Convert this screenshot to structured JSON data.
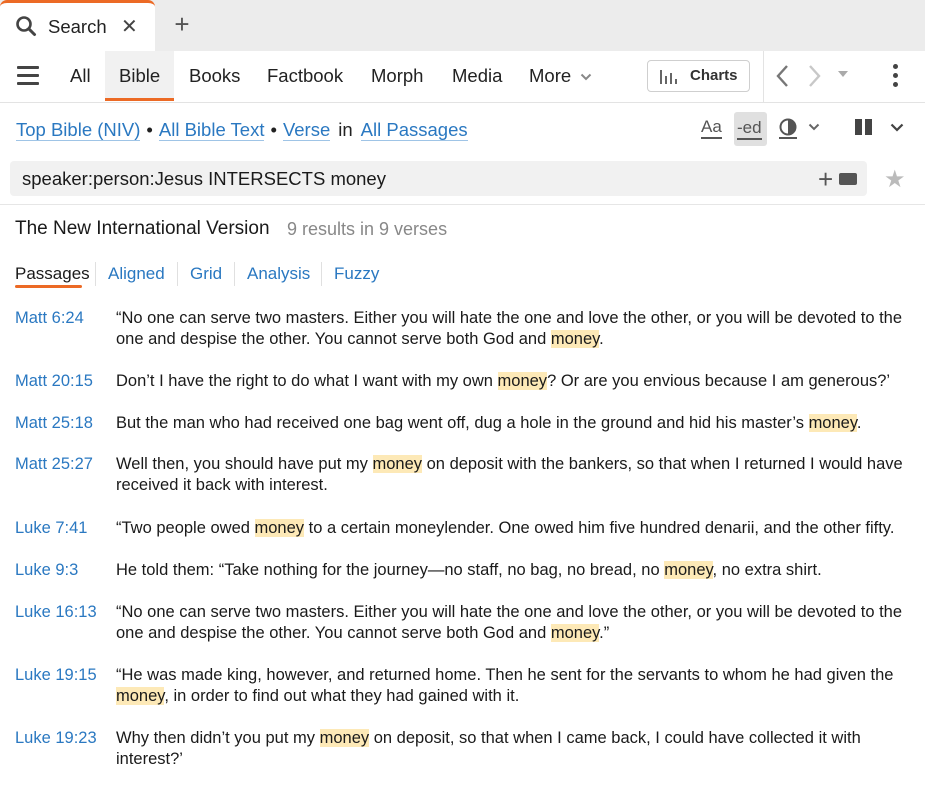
{
  "tab": {
    "title": "Search",
    "close_glyph": "✕",
    "new_tab_glyph": "+"
  },
  "nav": {
    "tabs": [
      "All",
      "Bible",
      "Books",
      "Factbook",
      "Morph",
      "Media",
      "More"
    ],
    "active_tab": "Bible",
    "charts_label": "Charts"
  },
  "scope": {
    "bible": "Top Bible (NIV)",
    "text": "All Bible Text",
    "unit": "Verse",
    "in_label": "in",
    "range": "All Passages",
    "separator": "•"
  },
  "tools": {
    "aa_label": "Aa",
    "ed_label": "-ed"
  },
  "search": {
    "query": "speaker:person:Jesus INTERSECTS money"
  },
  "results": {
    "version": "The New International Version",
    "count_text": "9 results in 9 verses",
    "subtabs": [
      "Passages",
      "Aligned",
      "Grid",
      "Analysis",
      "Fuzzy"
    ],
    "active_subtab": "Passages"
  },
  "verses": [
    {
      "ref": "Matt 6:24",
      "before": "“No one can serve two masters. Either you will hate the one and love the other, or you will be devoted to the one and despise the other. You cannot serve both God and ",
      "hit": "money",
      "after": "."
    },
    {
      "ref": "Matt 20:15",
      "before": "Don’t I have the right to do what I want with my own ",
      "hit": "money",
      "after": "? Or are you envious because I am generous?’"
    },
    {
      "ref": "Matt 25:18",
      "before": "But the man who had received one bag went off, dug a hole in the ground and hid his master’s ",
      "hit": "money",
      "after": "."
    },
    {
      "ref": "Matt 25:27",
      "before": "Well then, you should have put my ",
      "hit": "money",
      "after": " on deposit with the bankers, so that when I returned I would have received it back with interest."
    },
    {
      "ref": "Luke 7:41",
      "before": "“Two people owed ",
      "hit": "money",
      "after": " to a certain moneylender. One owed him five hundred denarii, and the other fifty."
    },
    {
      "ref": "Luke 9:3",
      "before": "He told them: “Take nothing for the journey—no staff, no bag, no bread, no ",
      "hit": "money",
      "after": ", no extra shirt."
    },
    {
      "ref": "Luke 16:13",
      "before": "“No one can serve two masters. Either you will hate the one and love the other, or you will be devoted to the one and despise the other. You cannot serve both God and ",
      "hit": "money",
      "after": ".”"
    },
    {
      "ref": "Luke 19:15",
      "before": "“He was made king, however, and returned home. Then he sent for the servants to whom he had given the ",
      "hit": "money",
      "after": ", in order to find out what they had gained with it."
    },
    {
      "ref": "Luke 19:23",
      "before": "Why then didn’t you put my ",
      "hit": "money",
      "after": " on deposit, so that when I came back, I could have collected it with interest?’"
    }
  ],
  "colors": {
    "accent": "#ec6a25",
    "link": "#2a78c1",
    "highlight": "#fde9b7"
  },
  "icons": [
    "search-icon",
    "close-icon",
    "plus-icon",
    "hamburger-menu-icon",
    "chevron-down-icon",
    "bar-chart-icon",
    "chevron-left-icon",
    "chevron-right-icon",
    "kebab-menu-icon",
    "visual-filter-icon",
    "columns-layout-icon",
    "keyboard-icon",
    "star-icon"
  ]
}
